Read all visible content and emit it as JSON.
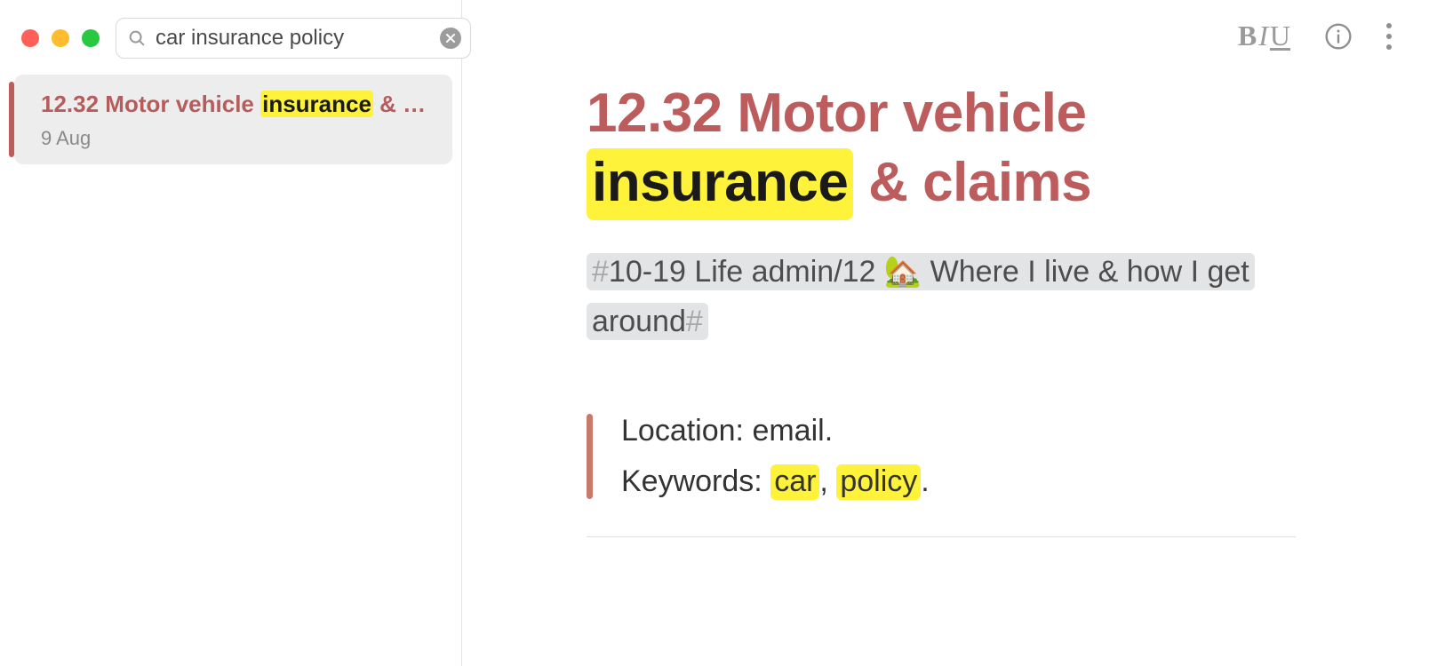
{
  "search": {
    "value": "car insurance policy"
  },
  "results": [
    {
      "title_pre": "12.32 Motor vehicle ",
      "title_hl": "insurance",
      "title_post": " & c...",
      "date": "9 Aug"
    }
  ],
  "toolbar": {
    "bold": "B",
    "italic": "I",
    "underline": "U"
  },
  "note": {
    "title_pre": "12.32 Motor vehicle ",
    "title_hl": "insurance",
    "title_post": " & claims",
    "breadcrumb_hash_open": "#",
    "breadcrumb_text": "10-19 Life admin/12 🏡 Where I live & how I get around",
    "breadcrumb_hash_close": "#",
    "location_label": "Location: ",
    "location_value": "email.",
    "keywords_label": "Keywords: ",
    "kw1": "car",
    "kw_sep": ", ",
    "kw2": "policy",
    "kw_end": "."
  }
}
